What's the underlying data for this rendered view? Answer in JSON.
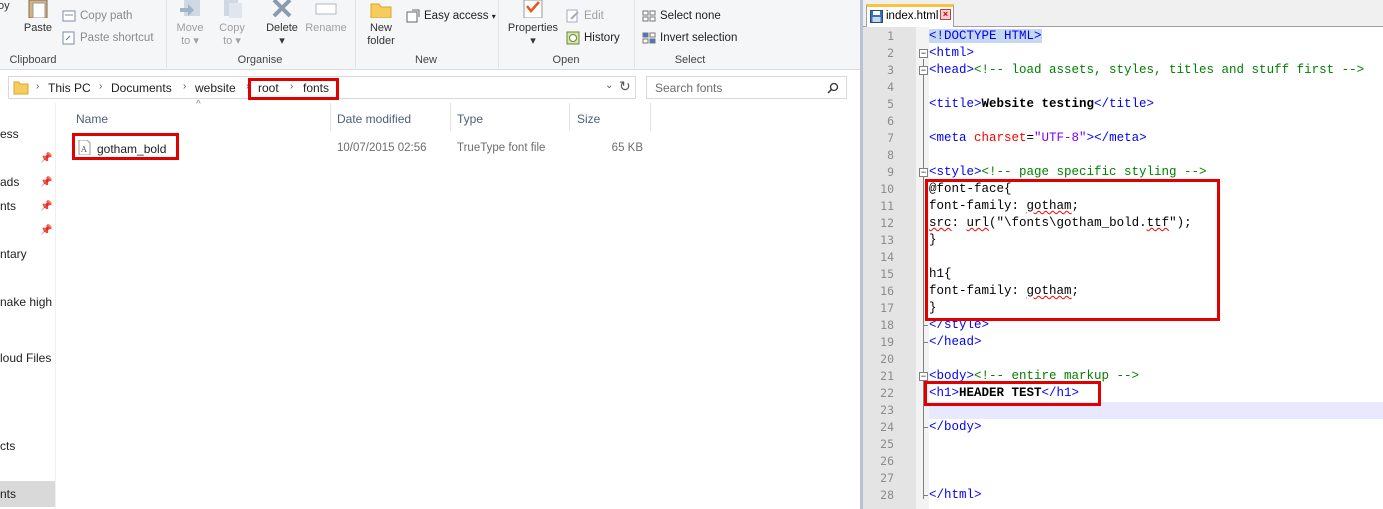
{
  "ribbon": {
    "paste": "Paste",
    "copy_path": "Copy path",
    "paste_shortcut": "Paste shortcut",
    "clipboard_label": "Clipboard",
    "move_to": [
      "Move",
      "to"
    ],
    "copy_to": [
      "Copy",
      "to"
    ],
    "delete": "Delete",
    "rename": "Rename",
    "organise_label": "Organise",
    "new_folder": [
      "New",
      "folder"
    ],
    "easy_access": "Easy access",
    "new_label": "New",
    "properties": "Properties",
    "edit": "Edit",
    "history": "History",
    "open_label": "Open",
    "select_none": "Select none",
    "invert_selection": "Invert selection",
    "select_label": "Select",
    "clipboard_label_partial": "oy"
  },
  "address": {
    "crumbs": [
      "This PC",
      "Documents",
      "website",
      "root",
      "fonts"
    ],
    "search_placeholder": "Search fonts"
  },
  "nav": {
    "items": [
      "ess",
      "ads",
      "nts",
      "ntary",
      "nake high",
      "loud Files",
      "cts",
      "nts"
    ]
  },
  "file_list": {
    "columns": [
      "Name",
      "Date modified",
      "Type",
      "Size"
    ],
    "rows": [
      {
        "name": "gotham_bold",
        "date": "10/07/2015 02:56",
        "type": "TrueType font file",
        "size": "65 KB"
      }
    ]
  },
  "editor": {
    "tab_title": "index.html",
    "line_numbers": [
      "1",
      "2",
      "3",
      "4",
      "5",
      "6",
      "7",
      "8",
      "9",
      "10",
      "11",
      "12",
      "13",
      "14",
      "15",
      "16",
      "17",
      "18",
      "19",
      "20",
      "21",
      "22",
      "23",
      "24",
      "25",
      "26",
      "27",
      "28"
    ],
    "lines": {
      "l1": "<!DOCTYPE HTML>",
      "l2": "<html>",
      "l3_tag": "<head>",
      "l3_cmt": "<!-- load assets, styles, titles and stuff first -->",
      "l5_open": "<title>",
      "l5_text": "Website testing",
      "l5_close": "</title>",
      "l7_open": "<meta ",
      "l7_attr": "charset",
      "l7_eq": "=",
      "l7_val": "\"UTF-8\"",
      "l7_close": "></meta>",
      "l9_tag": "<style>",
      "l9_cmt": "<!-- page specific styling -->",
      "l10": "@font-face{",
      "l11_a": "font-family: ",
      "l11_b": "gotham",
      "l11_c": ";",
      "l12_a": "src",
      "l12_b": ": ",
      "l12_c": "url",
      "l12_d": "(\"\\fonts\\gotham_bold.",
      "l12_e": "ttf",
      "l12_f": "\");",
      "l13": "}",
      "l15": "h1{",
      "l16_a": "font-family: ",
      "l16_b": "gotham",
      "l16_c": ";",
      "l17": "}",
      "l18": "</style>",
      "l19": "</head>",
      "l21_tag": "<body>",
      "l21_cmt": "<!-- entire markup -->",
      "l22_open": "<h1>",
      "l22_text": "HEADER TEST",
      "l22_close": "</h1>",
      "l24": "</body>",
      "l28": "</html>"
    }
  },
  "colors": {
    "highlight": "#e00000",
    "tag": "#0000ff",
    "comment": "#008000",
    "attr": "#ff0000",
    "string": "#8000ff"
  }
}
